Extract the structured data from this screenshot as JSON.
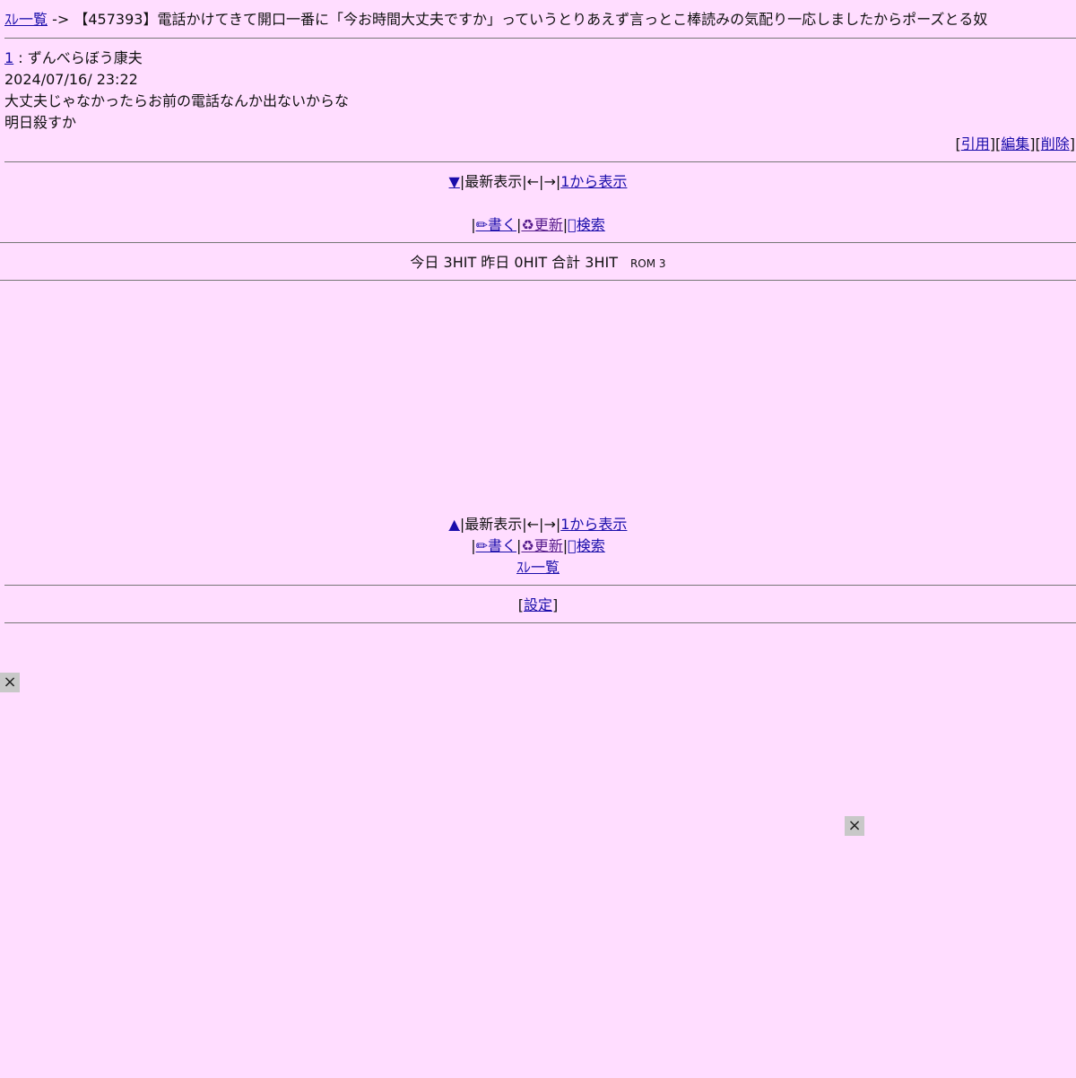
{
  "header": {
    "thread_list_link": "ｽﾚ一覧",
    "arrow": " -> ",
    "thread_title": "【457393】電話かけてきて開口一番に「今お時間大丈夫ですか」っていうとりあえず言っとこ棒読みの気配り一応しましたからポーズとる奴"
  },
  "post": {
    "number": "1",
    "separator": " : ",
    "author": "ずんべらぼう康夫",
    "date": "2024/07/16/ 23:22",
    "body_lines": [
      "大丈夫じゃなかったらお前の電話なんか出ないからな",
      "明日殺すか"
    ],
    "actions": {
      "open": "[",
      "quote": "引用",
      "mid1": "][",
      "edit": "編集",
      "mid2": "][",
      "delete": "削除",
      "close": "]"
    }
  },
  "nav_top": {
    "down_arrow": "▼",
    "latest": "|最新表示|←|→|",
    "from_first": "1から表示",
    "bar": "|",
    "write": "✏書く",
    "refresh": "♻更新",
    "search": "􀀀検索"
  },
  "counter": {
    "text": "今日 3HIT 昨日 0HIT 合計 3HIT",
    "rom": "ROM 3"
  },
  "nav_bottom": {
    "up_arrow": "▲",
    "latest": "|最新表示|←|→|",
    "from_first": "1から表示",
    "bar": "|",
    "write": "✏書く",
    "refresh": "♻更新",
    "search": "􀀀検索",
    "thread_list": "ｽﾚ一覧"
  },
  "settings": {
    "open": "[",
    "label": "設定",
    "close": "]"
  },
  "close_buttons": {
    "left": "×",
    "right": "×"
  }
}
